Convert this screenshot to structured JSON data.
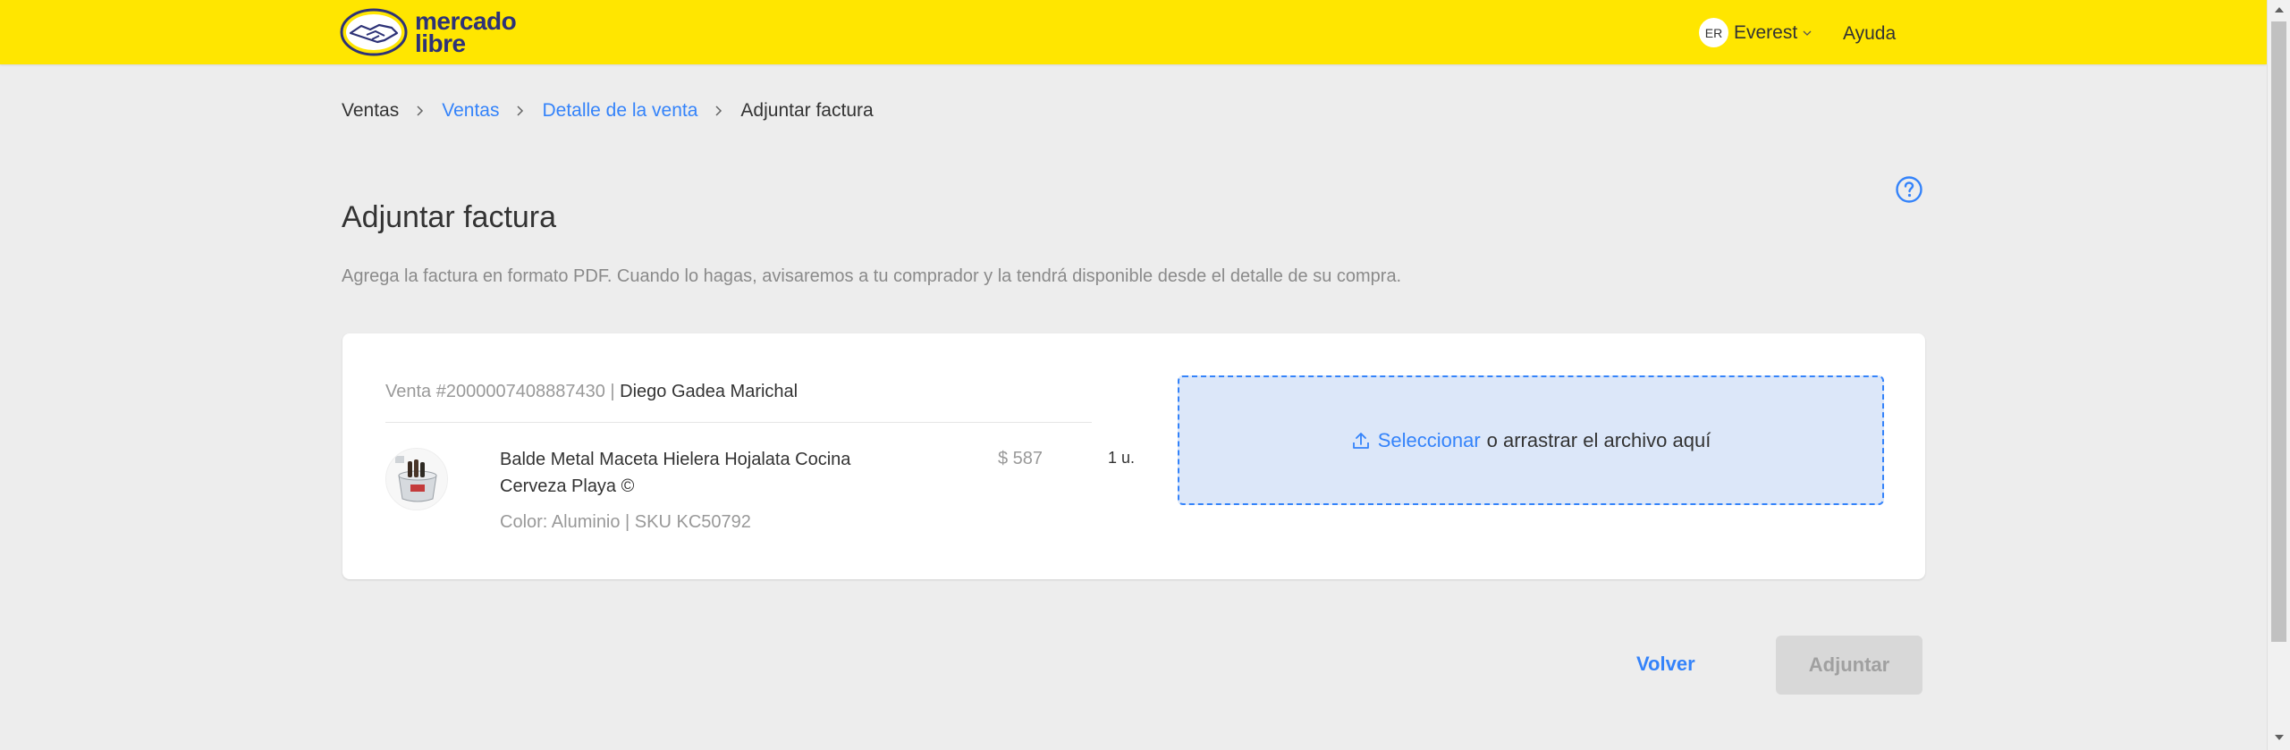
{
  "header": {
    "logo_line1": "mercado",
    "logo_line2": "libre",
    "user_initials": "ER",
    "user_name": "Everest",
    "help_label": "Ayuda"
  },
  "breadcrumb": {
    "items": [
      "Ventas",
      "Ventas",
      "Detalle de la venta",
      "Adjuntar factura"
    ]
  },
  "page": {
    "title": "Adjuntar factura",
    "subtitle": "Agrega la factura en formato PDF. Cuando lo hagas, avisaremos a tu comprador y la tendrá disponible desde el detalle de su compra."
  },
  "sale": {
    "number_label": "Venta #2000007408887430",
    "separator": " | ",
    "buyer": "Diego Gadea Marichal"
  },
  "product": {
    "title": "Balde Metal Maceta Hielera Hojalata Cocina Cerveza Playa ©",
    "meta": "Color: Aluminio | SKU KC50792",
    "price": "$ 587",
    "quantity": "1 u."
  },
  "dropzone": {
    "link_text": "Seleccionar",
    "rest_text": "o arrastrar el archivo aquí"
  },
  "actions": {
    "back_label": "Volver",
    "attach_label": "Adjuntar"
  },
  "colors": {
    "header_bg": "#ffe600",
    "accent": "#3483fa",
    "dropzone_bg": "#dce7f9"
  }
}
